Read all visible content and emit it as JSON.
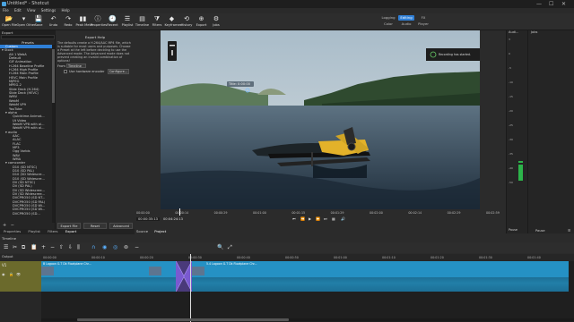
{
  "window": {
    "title": "Untitled* - Shotcut",
    "controls": [
      "—",
      "☐",
      "✕"
    ]
  },
  "menu": [
    "File",
    "Edit",
    "View",
    "Settings",
    "Help"
  ],
  "toolbar": [
    {
      "label": "Open File",
      "icon": "folder-open-icon",
      "glyph": "📂"
    },
    {
      "label": "Open Other",
      "icon": "open-other-icon",
      "glyph": "▾"
    },
    {
      "label": "Save",
      "icon": "save-icon",
      "glyph": "💾"
    },
    {
      "label": "Undo",
      "icon": "undo-icon",
      "glyph": "↶"
    },
    {
      "label": "Redo",
      "icon": "redo-icon",
      "glyph": "↷"
    },
    {
      "label": "Peak Meter",
      "icon": "peak-meter-icon",
      "glyph": "▮▮"
    },
    {
      "label": "Properties",
      "icon": "properties-icon",
      "glyph": "ⓘ"
    },
    {
      "label": "Recent",
      "icon": "recent-icon",
      "glyph": "🕘"
    },
    {
      "label": "Playlist",
      "icon": "playlist-icon",
      "glyph": "☰"
    },
    {
      "label": "Timeline",
      "icon": "timeline-icon",
      "glyph": "▤"
    },
    {
      "label": "Filters",
      "icon": "filters-icon",
      "glyph": "⧩"
    },
    {
      "label": "Keyframes",
      "icon": "keyframes-icon",
      "glyph": "◆"
    },
    {
      "label": "History",
      "icon": "history-icon",
      "glyph": "⟲"
    },
    {
      "label": "Export",
      "icon": "export-icon",
      "glyph": "⊕"
    },
    {
      "label": "Jobs",
      "icon": "jobs-icon",
      "glyph": "⚙"
    }
  ],
  "layout_tabs": {
    "logging": "Logging",
    "editing": "Editing",
    "fx": "FX"
  },
  "layout_sub": {
    "color": "Color",
    "audio": "Audio",
    "player": "Player"
  },
  "export_header": "Export",
  "presets": {
    "heading": "Presets",
    "items": [
      {
        "t": "Custom",
        "i": 1
      },
      {
        "t": "▾ Stock",
        "i": 0
      },
      {
        "t": "Alt 1 WebA",
        "i": 2
      },
      {
        "t": "Default",
        "i": 2
      },
      {
        "t": "GIF Animation",
        "i": 2
      },
      {
        "t": "H.264 Baseline Profile",
        "i": 2
      },
      {
        "t": "H.264 High Profile",
        "i": 2
      },
      {
        "t": "H.264 Main Profile",
        "i": 2
      },
      {
        "t": "HEVC Main Profile",
        "i": 2
      },
      {
        "t": "MJPEG",
        "i": 2
      },
      {
        "t": "MPEG-2",
        "i": 2
      },
      {
        "t": "Slide Deck (H.264)",
        "i": 2
      },
      {
        "t": "Slide Deck (HEVC)",
        "i": 2
      },
      {
        "t": "WMV",
        "i": 2
      },
      {
        "t": "WebM",
        "i": 2
      },
      {
        "t": "WebM VP9",
        "i": 2
      },
      {
        "t": "YouTube",
        "i": 2
      },
      {
        "t": "▾ alpha",
        "i": 1
      },
      {
        "t": "Quicktime Animat...",
        "i": 3
      },
      {
        "t": "Ut Video",
        "i": 3
      },
      {
        "t": "WebM VP8 with al...",
        "i": 3
      },
      {
        "t": "WebM VP9 with al...",
        "i": 3
      },
      {
        "t": "▾ audio",
        "i": 1
      },
      {
        "t": "AAC",
        "i": 3
      },
      {
        "t": "ALAC",
        "i": 3
      },
      {
        "t": "FLAC",
        "i": 3
      },
      {
        "t": "MP3",
        "i": 3
      },
      {
        "t": "Ogg Vorbis",
        "i": 3
      },
      {
        "t": "WAV",
        "i": 3
      },
      {
        "t": "WMA",
        "i": 3
      },
      {
        "t": "▾ camcorder",
        "i": 1
      },
      {
        "t": "D10 (SD NTSC)",
        "i": 3
      },
      {
        "t": "D10 (SD PAL)",
        "i": 3
      },
      {
        "t": "D10 (SD Widescre...",
        "i": 3
      },
      {
        "t": "D10 (SD Widescre...",
        "i": 3
      },
      {
        "t": "DV (SD NTSC)",
        "i": 3
      },
      {
        "t": "DV (SD PAL)",
        "i": 3
      },
      {
        "t": "DV (SD Widescree...",
        "i": 3
      },
      {
        "t": "DV (SD Widescree...",
        "i": 3
      },
      {
        "t": "DVCPRO50 (SD NT...",
        "i": 3
      },
      {
        "t": "DVCPRO50 (SD PAL)",
        "i": 3
      },
      {
        "t": "DVCPRO50 (SD Wi...",
        "i": 3
      },
      {
        "t": "DVCPRO50 (SD Wi...",
        "i": 3
      },
      {
        "t": "DVCPRO50 (SD...",
        "i": 3
      }
    ],
    "buttons": [
      "+",
      "−"
    ]
  },
  "export_panel": {
    "title": "Export Help",
    "description": "The defaults create a H.264/AAC MP4 file, which is suitable for most users and purposes. Choose a Preset at the left before deciding to use the Advanced mode. The Advanced mode does not prevent creating an invalid combination of options!",
    "from_label": "From",
    "from_value": "Timeline",
    "hw_label": "Use hardware encoder",
    "configure": "Configure...",
    "export_file": "Export File",
    "reset": "Reset",
    "advanced": "Advanced"
  },
  "left_tabs": [
    "Properties",
    "Playlist",
    "Filters",
    "Export"
  ],
  "player": {
    "overlay_label": "Title: 0:00:00",
    "notification": "Recording has started.",
    "ruler": [
      "00:00:00",
      "00:00:14",
      "00:00:29",
      "00:01:00",
      "00:01:15",
      "00:01:29",
      "00:02:00",
      "00:02:14",
      "00:02:29",
      "00:02:59"
    ],
    "timecode": "00:00:35:13",
    "duration": "00:04:24:13",
    "tabs": [
      "Source",
      "Project"
    ]
  },
  "audio_panel": {
    "label": "Audi...",
    "scale": [
      "3",
      "0",
      "-5",
      "-10",
      "-15",
      "-20",
      "-25",
      "-30",
      "-35",
      "-40",
      "-50"
    ],
    "pause": "Pause"
  },
  "jobs_panel": {
    "label": "Jobs"
  },
  "timeline": {
    "header": "Timeline",
    "output_label": "Output",
    "track_name": "V1",
    "ruler": [
      "00:00:00",
      "00:00:10",
      "00:00:20",
      "00:00:30",
      "00:00:40",
      "00:00:50",
      "00:01:00",
      "00:01:10",
      "00:01:20",
      "00:01:30",
      "00:01:40"
    ],
    "clips": [
      {
        "name": "B Lagoon G.T Dk Floatplane Chr..."
      },
      {
        "name": ""
      },
      {
        "name": "5.4 Lagoon G.T Dk Floatplane Chr..."
      }
    ]
  }
}
